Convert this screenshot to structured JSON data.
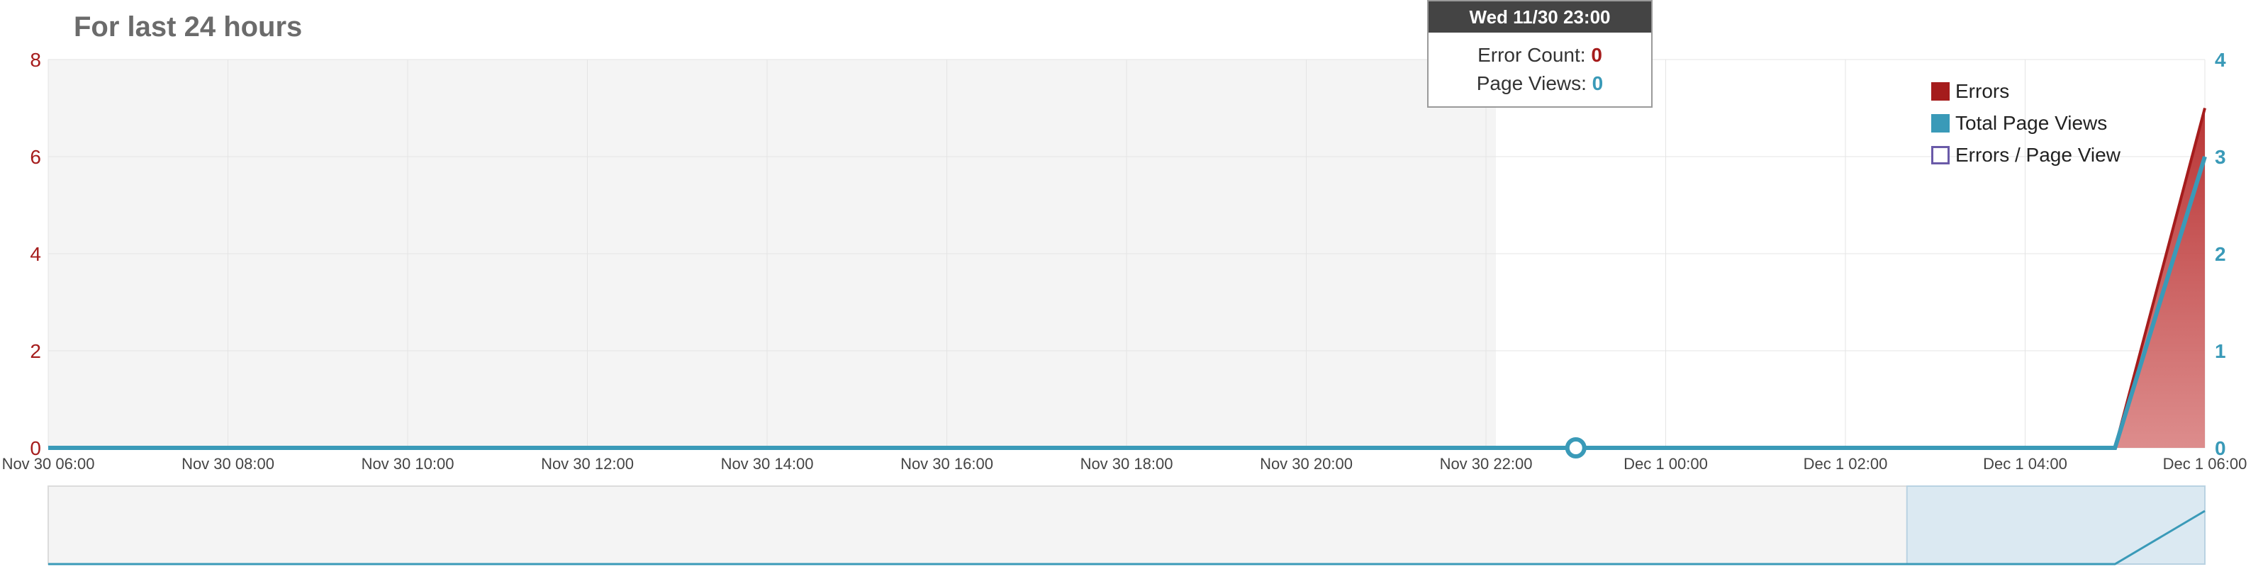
{
  "title": "For last 24 hours",
  "tooltip": {
    "header": "Wed 11/30 23:00",
    "error_label": "Error Count:",
    "error_value": "0",
    "views_label": "Page Views:",
    "views_value": "0"
  },
  "legend": [
    {
      "label": "Errors",
      "color": "#a51c1c",
      "style": "filled"
    },
    {
      "label": "Total Page Views",
      "color": "#3a9ab8",
      "style": "filled"
    },
    {
      "label": "Errors / Page View",
      "color": "#6a5aa8",
      "style": "outline"
    }
  ],
  "colors": {
    "errors": "#a51c1c",
    "page_views": "#3a9ab8",
    "plot_bg": "#f4f4f4",
    "navigator_selection": "#dbe9f2"
  },
  "chart_data": {
    "type": "area",
    "title": "For last 24 hours",
    "grid": true,
    "legend_position": "top-right",
    "x_tick_labels": [
      "Nov 30 06:00",
      "Nov 30 08:00",
      "Nov 30 10:00",
      "Nov 30 12:00",
      "Nov 30 14:00",
      "Nov 30 16:00",
      "Nov 30 18:00",
      "Nov 30 20:00",
      "Nov 30 22:00",
      "Dec 1 00:00",
      "Dec 1 02:00",
      "Dec 1 04:00",
      "Dec 1 06:00"
    ],
    "x": [
      "Nov 30 06:00",
      "Nov 30 07:00",
      "Nov 30 08:00",
      "Nov 30 09:00",
      "Nov 30 10:00",
      "Nov 30 11:00",
      "Nov 30 12:00",
      "Nov 30 13:00",
      "Nov 30 14:00",
      "Nov 30 15:00",
      "Nov 30 16:00",
      "Nov 30 17:00",
      "Nov 30 18:00",
      "Nov 30 19:00",
      "Nov 30 20:00",
      "Nov 30 21:00",
      "Nov 30 22:00",
      "Nov 30 23:00",
      "Dec 1 00:00",
      "Dec 1 01:00",
      "Dec 1 02:00",
      "Dec 1 03:00",
      "Dec 1 04:00",
      "Dec 1 05:00",
      "Dec 1 06:00"
    ],
    "y_left": {
      "ticks": [
        0,
        2,
        4,
        6,
        8
      ],
      "range": [
        0,
        8
      ],
      "color": "#a51c1c"
    },
    "y_right": {
      "ticks": [
        0,
        1,
        2,
        3,
        4
      ],
      "range": [
        0,
        4
      ],
      "color": "#3a9ab8"
    },
    "series": [
      {
        "name": "Errors",
        "axis": "left",
        "values": [
          0,
          0,
          0,
          0,
          0,
          0,
          0,
          0,
          0,
          0,
          0,
          0,
          0,
          0,
          0,
          0,
          0,
          0,
          0,
          0,
          0,
          0,
          0,
          0,
          7
        ]
      },
      {
        "name": "Total Page Views",
        "axis": "right",
        "values": [
          0,
          0,
          0,
          0,
          0,
          0,
          0,
          0,
          0,
          0,
          0,
          0,
          0,
          0,
          0,
          0,
          0,
          0,
          0,
          0,
          0,
          0,
          0,
          0,
          3
        ]
      },
      {
        "name": "Errors / Page View",
        "axis": "right",
        "values": []
      }
    ],
    "highlighted_point": {
      "x": "Nov 30 23:00",
      "series": "Total Page Views",
      "value": 0
    },
    "navigator_selection": {
      "start": "Dec 1 03:00",
      "end": "Dec 1 06:00"
    }
  }
}
